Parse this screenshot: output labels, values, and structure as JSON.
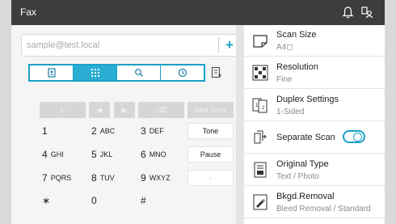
{
  "titlebar": {
    "title": "Fax",
    "icons": [
      "bell-icon",
      "user-icon"
    ]
  },
  "address": {
    "placeholder": "sample@test.local",
    "add_label": "+"
  },
  "tabs": [
    {
      "name": "address-book",
      "icon": "address-book-icon"
    },
    {
      "name": "direct-input",
      "icon": "keypad-icon",
      "active": true
    },
    {
      "name": "search",
      "icon": "search-icon"
    },
    {
      "name": "history",
      "icon": "history-icon"
    }
  ],
  "keypad": {
    "row0": [
      "C",
      "◀",
      "▶",
      "⌫",
      "Next Dest."
    ],
    "row1": [
      {
        "big": "1",
        "small": ""
      },
      {
        "big": "2",
        "small": "ABC"
      },
      {
        "big": "3",
        "small": "DEF"
      }
    ],
    "row1_btn": "Tone",
    "row2": [
      {
        "big": "4",
        "small": "GHI"
      },
      {
        "big": "5",
        "small": "JKL"
      },
      {
        "big": "6",
        "small": "MNO"
      }
    ],
    "row2_btn": "Pause",
    "row3": [
      {
        "big": "7",
        "small": "PQRS"
      },
      {
        "big": "8",
        "small": "TUV"
      },
      {
        "big": "9",
        "small": "WXYZ"
      }
    ],
    "row3_btn": "-",
    "row4": [
      {
        "big": "∗",
        "small": ""
      },
      {
        "big": "0",
        "small": ""
      },
      {
        "big": "#",
        "small": ""
      }
    ]
  },
  "settings": [
    {
      "label": "Scan Size",
      "value": "A4◻"
    },
    {
      "label": "Resolution",
      "value": "Fine"
    },
    {
      "label": "Duplex Settings",
      "value": "1-Sided"
    },
    {
      "label": "Separate Scan",
      "toggle": "off"
    },
    {
      "label": "Original Type",
      "value": "Text / Photo"
    },
    {
      "label": "Bkgd.Removal",
      "value": "Bleed Removal / Standard"
    }
  ],
  "colors": {
    "accent": "#1aa0c8",
    "titlebar": "#3d3d3d"
  }
}
